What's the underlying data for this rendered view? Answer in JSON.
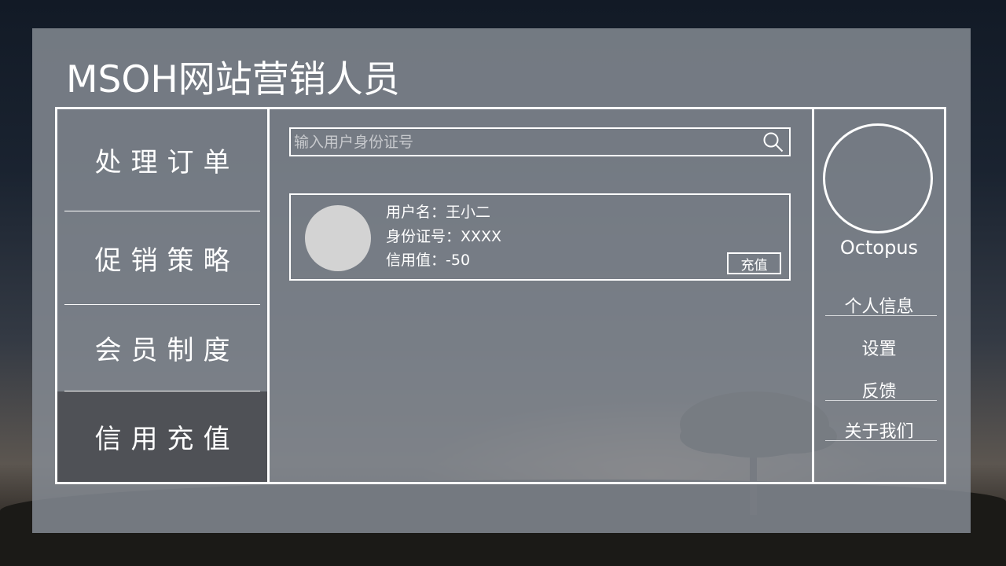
{
  "app": {
    "title": "MSOH网站营销人员"
  },
  "sidebar": {
    "items": [
      {
        "label": "处理订单",
        "active": false
      },
      {
        "label": "促销策略",
        "active": false
      },
      {
        "label": "会员制度",
        "active": false
      },
      {
        "label": "信用充值",
        "active": true
      }
    ]
  },
  "search": {
    "placeholder": "输入用户身份证号",
    "value": "",
    "icon": "search-icon"
  },
  "user_card": {
    "username": "用户名：王小二",
    "id_number": "身份证号：XXXX",
    "credit": "信用值：-50",
    "recharge_label": "充值"
  },
  "profile": {
    "name": "Octopus",
    "menu": [
      "个人信息",
      "设置",
      "反馈",
      "关于我们"
    ]
  },
  "colors": {
    "panel": "#84898f",
    "active_nav": "#4f5156",
    "border": "#ffffff",
    "avatar": "#d3d3d3"
  }
}
